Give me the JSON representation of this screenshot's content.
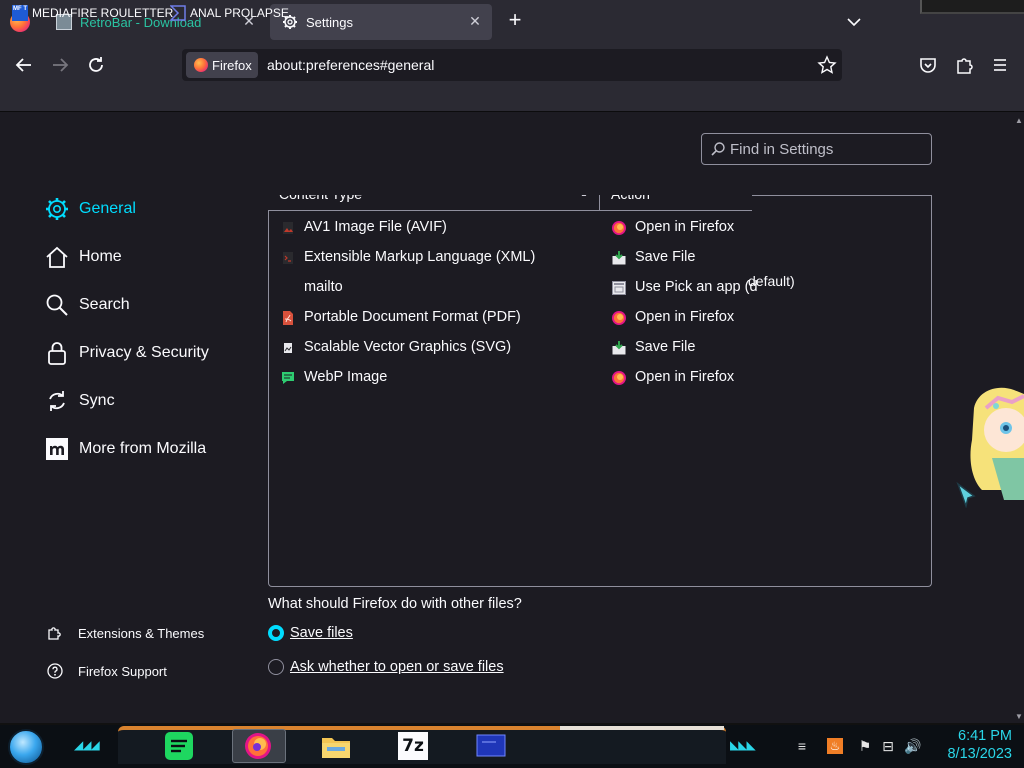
{
  "tabs": [
    {
      "title": "RetroBar - Download",
      "active": false
    },
    {
      "title": "Settings",
      "active": true
    }
  ],
  "navbar": {
    "identity_label": "Firefox",
    "url": "about:preferences#general"
  },
  "bookmarks": [
    {
      "label": "MEDIAFIRE ROULETTER",
      "icon": "mediafire-icon",
      "icon_text": "MF T"
    },
    {
      "label": "ANAL PROLAPSE",
      "icon": "bookmark-folder-icon"
    }
  ],
  "settings_search": {
    "placeholder": "Find in Settings"
  },
  "sidebar": {
    "categories": [
      {
        "label": "General",
        "icon": "gear-icon",
        "selected": true
      },
      {
        "label": "Home",
        "icon": "home-icon"
      },
      {
        "label": "Search",
        "icon": "search-icon"
      },
      {
        "label": "Privacy & Security",
        "icon": "lock-icon"
      },
      {
        "label": "Sync",
        "icon": "sync-icon"
      },
      {
        "label": "More from Mozilla",
        "icon": "mozilla-icon"
      }
    ],
    "footer": [
      {
        "label": "Extensions & Themes",
        "icon": "puzzle-icon"
      },
      {
        "label": "Firefox Support",
        "icon": "help-icon"
      }
    ]
  },
  "handlers": {
    "columns": [
      "Content Type",
      "Action"
    ],
    "rows": [
      {
        "type": "AV1 Image File (AVIF)",
        "action": "Open in Firefox",
        "type_icon": "avif-icon",
        "action_icon": "firefox-icon"
      },
      {
        "type": "Extensible Markup Language (XML)",
        "action": "Save File",
        "type_icon": "xml-icon",
        "action_icon": "save-file-icon"
      },
      {
        "type": "mailto",
        "action": "Use Pick an app (d",
        "type_icon": "",
        "action_icon": "app-icon"
      },
      {
        "type": "Portable Document Format (PDF)",
        "action": "Open in Firefox",
        "type_icon": "pdf-icon",
        "action_icon": "firefox-icon"
      },
      {
        "type": "Scalable Vector Graphics (SVG)",
        "action": "Save File",
        "type_icon": "svg-icon",
        "action_icon": "save-file-icon"
      },
      {
        "type": "WebP Image",
        "action": "Open in Firefox",
        "type_icon": "webp-icon",
        "action_icon": "firefox-icon"
      }
    ],
    "overflow_fragment": "default)"
  },
  "other_files": {
    "question": "What should Firefox do with other files?",
    "options": [
      {
        "label": "Save files",
        "checked": true
      },
      {
        "label": "Ask whether to open or save files",
        "checked": false
      }
    ]
  },
  "taskbar": {
    "apps": [
      "spotify-icon",
      "firefox-icon",
      "file-explorer-icon",
      "7zip-icon",
      "screen-icon"
    ],
    "seven_zip_label": "7z",
    "clock_time": "6:41 PM",
    "clock_date": "8/13/2023"
  },
  "colors": {
    "accent": "#00ddff",
    "bg": "#1c1b22",
    "chrome": "#2b2a33",
    "tab1_text": "#2ac3a2"
  }
}
